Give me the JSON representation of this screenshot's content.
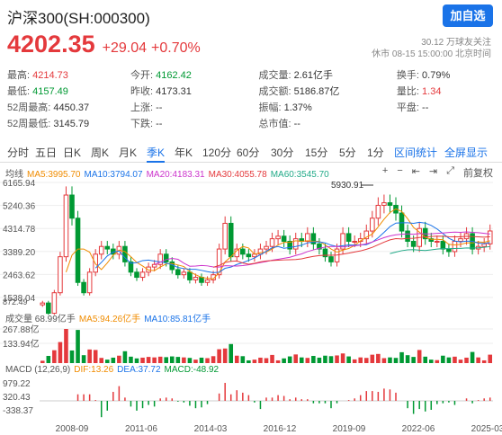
{
  "header": {
    "title": "沪深300(SH:000300)",
    "follow_label": "加自选",
    "price": "4202.35",
    "change": "+29.04",
    "change_pct": "+0.70%",
    "followers": "30.12 万球友关注",
    "status": "休市 08-15 15:00:00 北京时间"
  },
  "stats": [
    [
      {
        "k": "最高:",
        "v": "4214.73",
        "c": "red"
      },
      {
        "k": "今开:",
        "v": "4162.42",
        "c": "green"
      },
      {
        "k": "成交量:",
        "v": "2.61亿手",
        "c": ""
      },
      {
        "k": "换手:",
        "v": "0.79%",
        "c": ""
      }
    ],
    [
      {
        "k": "最低:",
        "v": "4157.49",
        "c": "green"
      },
      {
        "k": "昨收:",
        "v": "4173.31",
        "c": ""
      },
      {
        "k": "成交额:",
        "v": "5186.87亿",
        "c": ""
      },
      {
        "k": "量比:",
        "v": "1.34",
        "c": "red"
      }
    ],
    [
      {
        "k": "52周最高:",
        "v": "4450.37",
        "c": ""
      },
      {
        "k": "上涨:",
        "v": "--",
        "c": ""
      },
      {
        "k": "振幅:",
        "v": "1.37%",
        "c": ""
      },
      {
        "k": "平盘:",
        "v": "--",
        "c": ""
      }
    ],
    [
      {
        "k": "52周最低:",
        "v": "3145.79",
        "c": ""
      },
      {
        "k": "下跌:",
        "v": "--",
        "c": ""
      },
      {
        "k": "总市值:",
        "v": "--",
        "c": ""
      },
      {
        "k": "",
        "v": "",
        "c": ""
      }
    ]
  ],
  "tabs": [
    "分时",
    "五日",
    "日K",
    "周K",
    "月K",
    "季K",
    "年K",
    "120分",
    "60分",
    "30分",
    "15分",
    "5分",
    "1分"
  ],
  "active_tab": "季K",
  "tab_links": [
    "区间统计",
    "全屏显示"
  ],
  "toolbar": {
    "icons": [
      "plus-icon",
      "minus-icon",
      "step-left-icon",
      "step-right-icon",
      "expand-icon"
    ],
    "fuquan_label": "前复权"
  },
  "ma_legend": {
    "label": "均线",
    "items": [
      {
        "text": "MA5:3995.70",
        "color": "#f08c00"
      },
      {
        "text": "MA10:3794.07",
        "color": "#1a73e8"
      },
      {
        "text": "MA20:4183.31",
        "color": "#cc33cc"
      },
      {
        "text": "MA30:4055.78",
        "color": "#e4393c"
      },
      {
        "text": "MA60:3545.70",
        "color": "#22aa88"
      }
    ]
  },
  "vol_legend": {
    "label": "成交量 68.99亿手",
    "items": [
      {
        "text": "MA5:94.26亿手",
        "color": "#f08c00"
      },
      {
        "text": "MA10:85.81亿手",
        "color": "#1a73e8"
      }
    ]
  },
  "macd_legend": {
    "label": "MACD (12,26,9)",
    "items": [
      {
        "text": "DIF:13.26",
        "color": "#f08c00"
      },
      {
        "text": "DEA:37.72",
        "color": "#1a73e8"
      },
      {
        "text": "MACD:-48.92",
        "color": "#009933"
      }
    ]
  },
  "chart_data": {
    "type": "candlestick",
    "price_axis": [
      "6165.94",
      "5240.36",
      "4314.78",
      "3389.20",
      "2463.62",
      "1538.04"
    ],
    "price_ylim": [
      1300,
      6300
    ],
    "max_label": "5930.91",
    "min_label": "817.17",
    "min_axis_label": "872.49",
    "volume_axis": [
      "267.88亿",
      "133.94亿"
    ],
    "macd_axis": [
      "979.22",
      "320.43",
      "-338.37"
    ],
    "x_ticks": [
      "2008-09",
      "2011-06",
      "2014-03",
      "2016-12",
      "2019-09",
      "2022-06",
      "2025-03"
    ],
    "closes": [
      1400,
      1000,
      1800,
      3200,
      5600,
      4700,
      2200,
      1800,
      2600,
      3300,
      3600,
      3500,
      3300,
      3600,
      3000,
      2600,
      2400,
      2600,
      2800,
      2900,
      3300,
      3000,
      2700,
      2500,
      2600,
      2300,
      2400,
      2200,
      2300,
      2500,
      3500,
      4500,
      3200,
      3500,
      3300,
      3200,
      3300,
      3500,
      3600,
      3900,
      4000,
      3800,
      3500,
      3900,
      3800,
      4100,
      3700,
      3500,
      3200,
      3000,
      3500,
      4100,
      3800,
      3800,
      3900,
      4200,
      4700,
      5200,
      5300,
      5200,
      4900,
      4200,
      3800,
      3600,
      4300,
      3900,
      3800,
      3800,
      3500,
      3400,
      3800,
      3900,
      4100,
      3500,
      3600,
      3700,
      4202
    ]
  }
}
